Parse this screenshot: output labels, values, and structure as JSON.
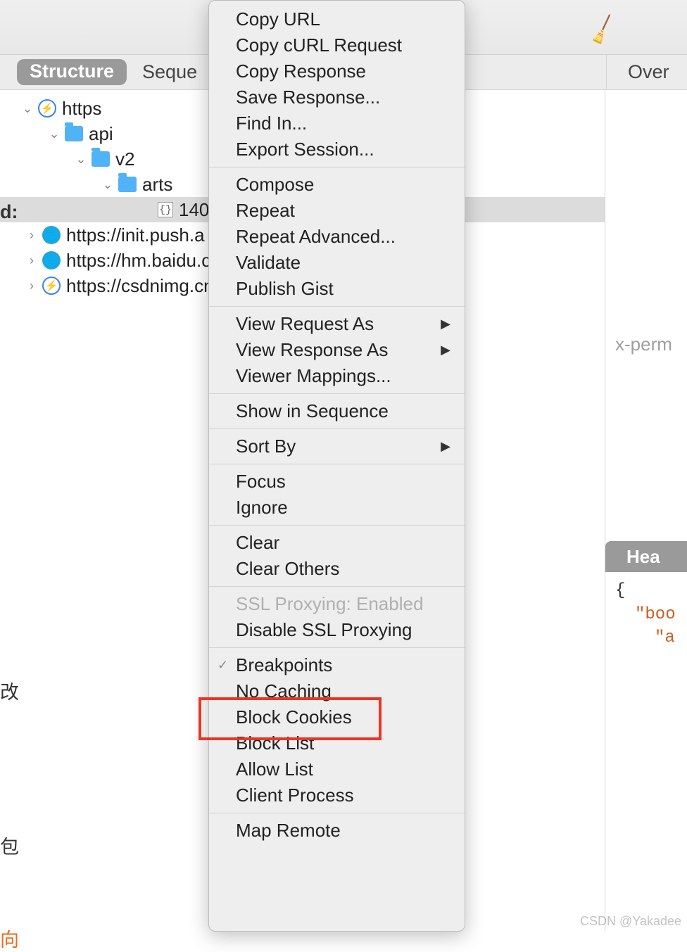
{
  "toolbar": {
    "broom_icon": "broom"
  },
  "tabs": {
    "structure": "Structure",
    "sequence": "Seque"
  },
  "tree": {
    "root_host": "https",
    "api": "api",
    "v2": "v2",
    "arts": "arts",
    "item_id": "140",
    "host2": "https://init.push.a",
    "host3": "https://hm.baidu.c",
    "host4": "https://csdnimg.cn"
  },
  "context_menu": {
    "copy_url": "Copy URL",
    "copy_curl": "Copy cURL Request",
    "copy_response": "Copy Response",
    "save_response": "Save Response...",
    "find_in": "Find In...",
    "export_session": "Export Session...",
    "compose": "Compose",
    "repeat": "Repeat",
    "repeat_advanced": "Repeat Advanced...",
    "validate": "Validate",
    "publish_gist": "Publish Gist",
    "view_request_as": "View Request As",
    "view_response_as": "View Response As",
    "viewer_mappings": "Viewer Mappings...",
    "show_in_sequence": "Show in Sequence",
    "sort_by": "Sort By",
    "focus": "Focus",
    "ignore": "Ignore",
    "clear": "Clear",
    "clear_others": "Clear Others",
    "ssl_proxying_enabled": "SSL Proxying: Enabled",
    "disable_ssl_proxying": "Disable SSL Proxying",
    "breakpoints": "Breakpoints",
    "no_caching": "No Caching",
    "block_cookies": "Block Cookies",
    "block_list": "Block List",
    "allow_list": "Allow List",
    "client_process": "Client Process",
    "map_remote": "Map Remote"
  },
  "right": {
    "tab_overview": "Over",
    "xperm_label": "x-perm",
    "headers_tab": "Hea",
    "json_open": "{",
    "json_body_key": "\"boo",
    "json_a_key": "\"a"
  },
  "edge": {
    "d_colon": "d:",
    "gai": "改",
    "bao": "包",
    "xiang": "向"
  },
  "watermark": "CSDN @Yakadee"
}
